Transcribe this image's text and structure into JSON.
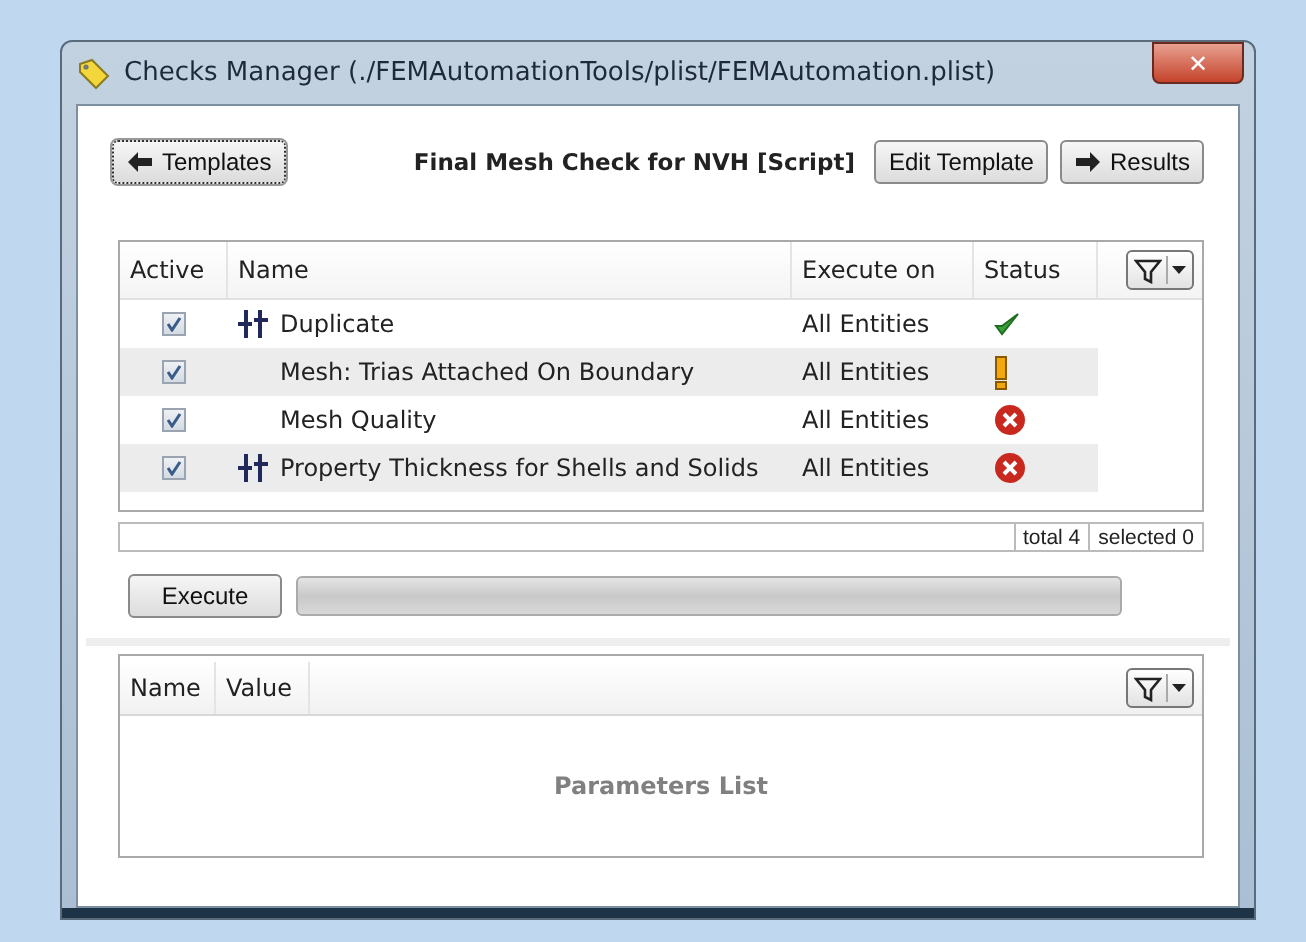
{
  "window": {
    "title": "Checks Manager (./FEMAutomationTools/plist/FEMAutomation.plist)",
    "close": "✕"
  },
  "toolbar": {
    "templates_button": "Templates",
    "script_title": "Final Mesh Check for NVH [Script]",
    "edit_button": "Edit Template",
    "results_button": "Results"
  },
  "checks_table": {
    "columns": [
      "Active",
      "Name",
      "Execute on",
      "Status"
    ],
    "rows": [
      {
        "active": true,
        "grouped": true,
        "name": "Duplicate",
        "execute_on": "All Entities",
        "status_icon": {
          "kind": "ok"
        }
      },
      {
        "active": true,
        "grouped": false,
        "name": "Mesh: Trias Attached On Boundary",
        "execute_on": "All Entities",
        "status_icon": {
          "kind": "warning"
        }
      },
      {
        "active": true,
        "grouped": false,
        "name": "Mesh Quality",
        "execute_on": "All Entities",
        "status_icon": {
          "kind": "error"
        }
      },
      {
        "active": true,
        "grouped": true,
        "name": "Property Thickness for Shells and Solids",
        "execute_on": "All Entities",
        "status_icon": {
          "kind": "error"
        }
      }
    ]
  },
  "status_bar": {
    "total": "total 4",
    "selected": "selected 0"
  },
  "execute_button": "Execute",
  "progress": {
    "level": 0
  },
  "parameters_table": {
    "columns": [
      "Name",
      "Value"
    ],
    "empty_text": "Parameters List"
  }
}
